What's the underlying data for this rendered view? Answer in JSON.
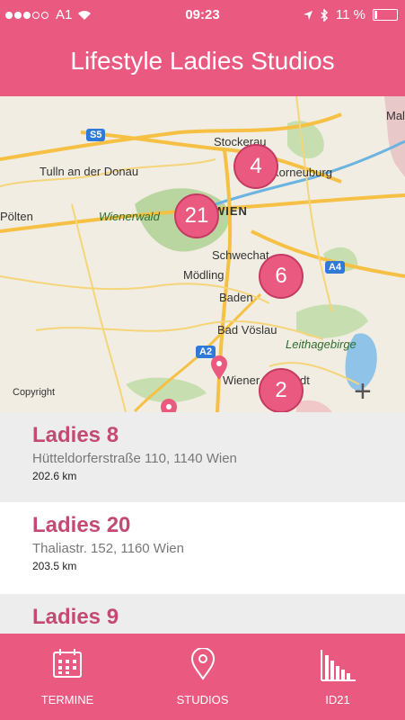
{
  "status": {
    "carrier": "A1",
    "time": "09:23",
    "battery": "11 %"
  },
  "header": {
    "title": "Lifestyle Ladies Studios"
  },
  "map": {
    "places": [
      {
        "id": "stockerau",
        "label": "Stockerau"
      },
      {
        "id": "korneuburg",
        "label": "Korneuburg"
      },
      {
        "id": "tulln",
        "label": "Tulln an der Donau"
      },
      {
        "id": "wienerwald",
        "label": "Wienerwald"
      },
      {
        "id": "wien",
        "label": "WIEN"
      },
      {
        "id": "polten",
        "label": "Pölten"
      },
      {
        "id": "schwechat",
        "label": "Schwechat"
      },
      {
        "id": "modling",
        "label": "Mödling"
      },
      {
        "id": "baden",
        "label": "Baden"
      },
      {
        "id": "voslau",
        "label": "Bad Vöslau"
      },
      {
        "id": "leitha",
        "label": "Leithagebirge"
      },
      {
        "id": "neustadt",
        "label": "Wiener Neustadt"
      },
      {
        "id": "mala",
        "label": "Mala"
      }
    ],
    "road_badges": [
      "S5",
      "A4",
      "A2"
    ],
    "clusters": [
      "4",
      "21",
      "6",
      "2"
    ],
    "copyright": "Copyright",
    "zoom_icon": "plus-icon"
  },
  "studios": [
    {
      "name": "Ladies 8",
      "address": "Hütteldorferstraße 110, 1140 Wien",
      "distance": "202.6 km"
    },
    {
      "name": "Ladies 20",
      "address": "Thaliastr. 152, 1160 Wien",
      "distance": "203.5 km"
    },
    {
      "name": "Ladies 9",
      "address": "",
      "distance": ""
    }
  ],
  "tabs": [
    {
      "label": "TERMINE",
      "icon": "calendar-icon"
    },
    {
      "label": "STUDIOS",
      "icon": "location-pin-icon"
    },
    {
      "label": "ID21",
      "icon": "bar-chart-icon"
    }
  ],
  "colors": {
    "brand": "#ea5a80",
    "title_pink": "#c34a72"
  }
}
